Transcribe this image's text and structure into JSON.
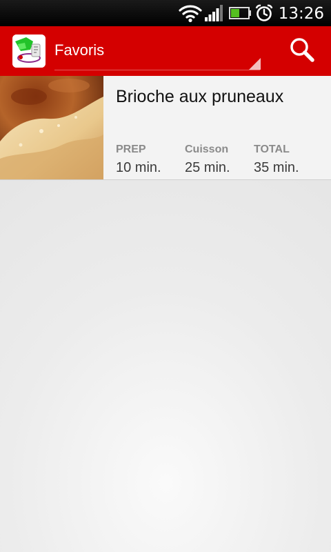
{
  "status_bar": {
    "time": "13:26",
    "icons": [
      "wifi-icon",
      "signal-icon",
      "battery-icon",
      "alarm-icon"
    ],
    "battery_level": 0.5
  },
  "action_bar": {
    "title": "Favoris",
    "logo_icon": "app-logo",
    "search_icon": "search-icon",
    "color": "#d40000"
  },
  "recipes": [
    {
      "title": "Brioche aux pruneaux",
      "prep_label": "PREP",
      "prep_value": "10 min.",
      "cook_label": "Cuisson",
      "cook_value": "25 min.",
      "total_label": "TOTAL",
      "total_value": "35 min."
    }
  ]
}
